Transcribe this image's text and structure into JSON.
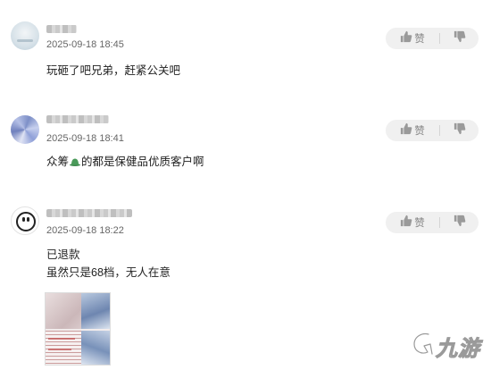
{
  "comments": [
    {
      "timestamp": "2025-09-18 18:45",
      "lines": [
        "玩砸了吧兄弟，赶紧公关吧"
      ],
      "like_label": "赞"
    },
    {
      "timestamp": "2025-09-18 18:41",
      "lines": [
        "众筹",
        "的都是保健品优质客户啊"
      ],
      "like_label": "赞"
    },
    {
      "timestamp": "2025-09-18 18:22",
      "lines": [
        "已退款",
        "虽然只是68档，无人在意"
      ],
      "like_label": "赞"
    }
  ],
  "icons": {
    "like": "thumbs-up-icon",
    "dislike": "thumbs-down-icon",
    "emoji": "green-hat-emoji"
  },
  "colors": {
    "action_bg": "#f0f0f0",
    "icon": "#9a9a9a",
    "emoji": "#4a9a5a"
  },
  "watermark": {
    "text": "九游"
  }
}
